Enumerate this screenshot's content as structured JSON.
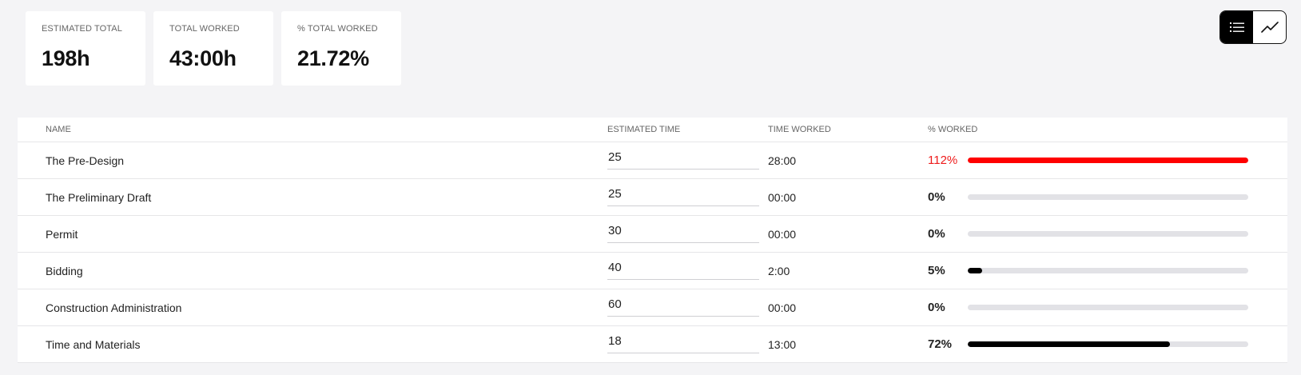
{
  "summary": {
    "estimated_total": {
      "label": "ESTIMATED TOTAL",
      "value": "198h"
    },
    "total_worked": {
      "label": "TOTAL WORKED",
      "value": "43:00h"
    },
    "pct_total_worked": {
      "label": "% TOTAL WORKED",
      "value": "21.72%"
    }
  },
  "view_toggle": {
    "options": [
      {
        "icon": "list-icon",
        "active": true
      },
      {
        "icon": "line-chart-icon",
        "active": false
      }
    ]
  },
  "table": {
    "headers": {
      "name": "NAME",
      "estimated_time": "ESTIMATED TIME",
      "time_worked": "TIME WORKED",
      "pct_worked": "% WORKED"
    },
    "rows": [
      {
        "name": "The Pre-Design",
        "estimated": "25",
        "worked": "28:00",
        "pct": "112%",
        "fraction": 1.0,
        "over": true
      },
      {
        "name": "The Preliminary Draft",
        "estimated": "25",
        "worked": "00:00",
        "pct": "0%",
        "fraction": 0.0,
        "over": false
      },
      {
        "name": "Permit",
        "estimated": "30",
        "worked": "00:00",
        "pct": "0%",
        "fraction": 0.0,
        "over": false
      },
      {
        "name": "Bidding",
        "estimated": "40",
        "worked": "2:00",
        "pct": "5%",
        "fraction": 0.05,
        "over": false
      },
      {
        "name": "Construction Administration",
        "estimated": "60",
        "worked": "00:00",
        "pct": "0%",
        "fraction": 0.0,
        "over": false
      },
      {
        "name": "Time and Materials",
        "estimated": "18",
        "worked": "13:00",
        "pct": "72%",
        "fraction": 0.72,
        "over": false
      }
    ]
  },
  "colors": {
    "over_budget": "#ff0000",
    "progress": "#000000",
    "track": "#e2e2e6"
  }
}
